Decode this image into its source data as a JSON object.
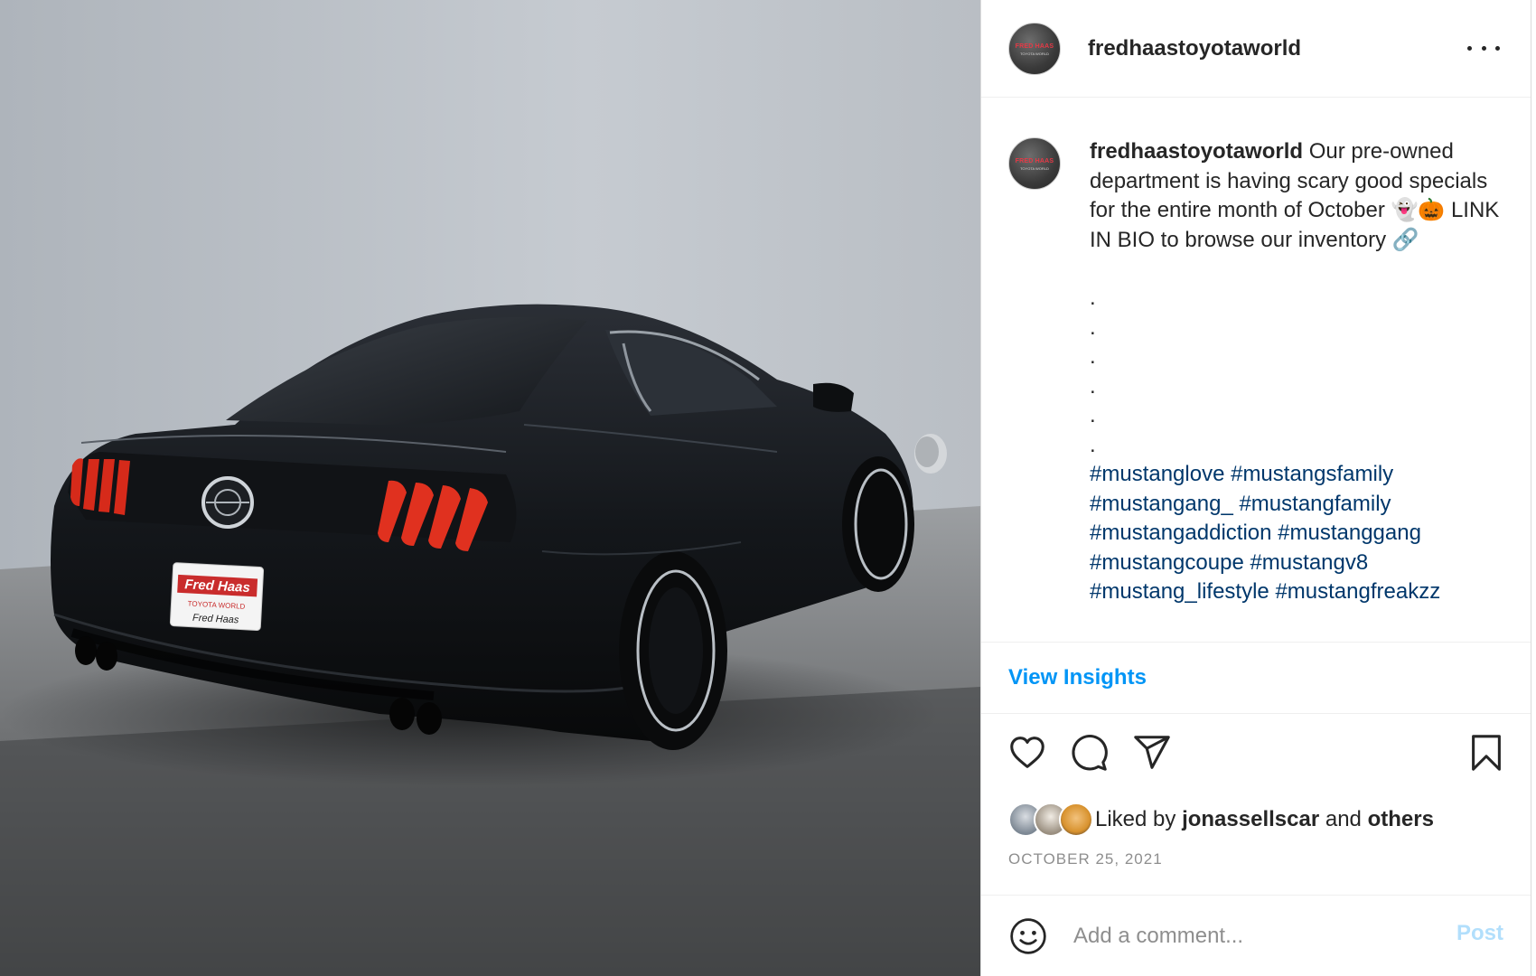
{
  "post": {
    "photo_alt": "",
    "account": {
      "username": "fredhaastoyotaworld",
      "avatar_text": "FRED HAAS",
      "avatar_subtext": "TOYOTA WORLD"
    },
    "caption": {
      "username": "fredhaastoyotaworld",
      "text": "Our pre-owned department is having scary good specials for the entire month of October 👻🎃 LINK IN BIO to browse our inventory 🔗",
      "dots": [
        ".",
        ".",
        ".",
        ".",
        ".",
        "."
      ],
      "hashtag_lines": [
        "#mustanglove #mustangsfamily",
        "#mustangang_ #mustangfamily",
        "#mustangaddiction #mustanggang",
        "#mustangcoupe #mustangv8",
        "#mustang_lifestyle #mustangfreakzz"
      ]
    },
    "insights_link": "View Insights",
    "likes": {
      "prefix": "Liked by ",
      "user": "jonassellscar",
      "middle": " and ",
      "others": "others"
    },
    "date": "OCTOBER 25, 2021",
    "comment": {
      "placeholder": "Add a comment...",
      "post_label": "Post"
    },
    "plate_text": "Fred Haas",
    "plate_sub": "TOYOTA WORLD",
    "icons": {
      "more": "more-options-icon",
      "like": "heart-icon",
      "comment": "comment-bubble-icon",
      "share": "paper-plane-icon",
      "save": "bookmark-icon",
      "emoji": "smiley-face-icon"
    },
    "colors": {
      "link_blue": "#0095f6",
      "hashtag_blue": "#00376b",
      "post_disabled": "#b2dffc",
      "muted_gray": "#8e8e8e",
      "text": "#262626"
    }
  }
}
